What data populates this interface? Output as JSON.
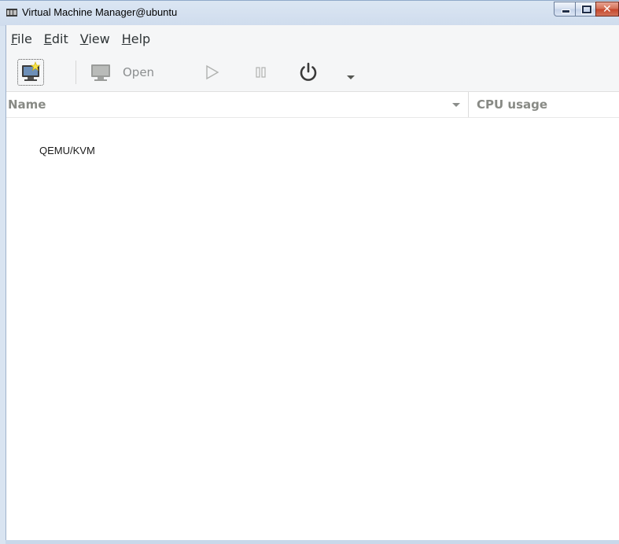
{
  "window": {
    "title": "Virtual Machine Manager@ubuntu",
    "icon": "vmm-app-icon",
    "controls": {
      "minimize_icon": "minimize-icon",
      "maximize_icon": "maximize-icon",
      "close_icon": "close-icon",
      "close_glyph": "✕"
    }
  },
  "menubar": {
    "items": [
      {
        "underline": "F",
        "rest": "ile"
      },
      {
        "underline": "E",
        "rest": "dit"
      },
      {
        "underline": "V",
        "rest": "iew"
      },
      {
        "underline": "H",
        "rest": "elp"
      }
    ]
  },
  "toolbar": {
    "new_vm_icon": "new-vm-icon",
    "open_label": "Open",
    "run_icon": "play-icon",
    "pause_icon": "pause-icon",
    "shutdown_icon": "power-icon",
    "shutdown_menu_icon": "chevron-down-icon"
  },
  "list": {
    "columns": {
      "name": "Name",
      "cpu": "CPU usage"
    },
    "sort_icon": "sort-down-icon",
    "rows": [
      {
        "name": "QEMU/KVM"
      }
    ]
  },
  "colors": {
    "titlebar": "#dbe6f3",
    "toolbar_bg": "#f5f6f7",
    "header_text": "#888a85",
    "close_red": "#c6452a"
  }
}
